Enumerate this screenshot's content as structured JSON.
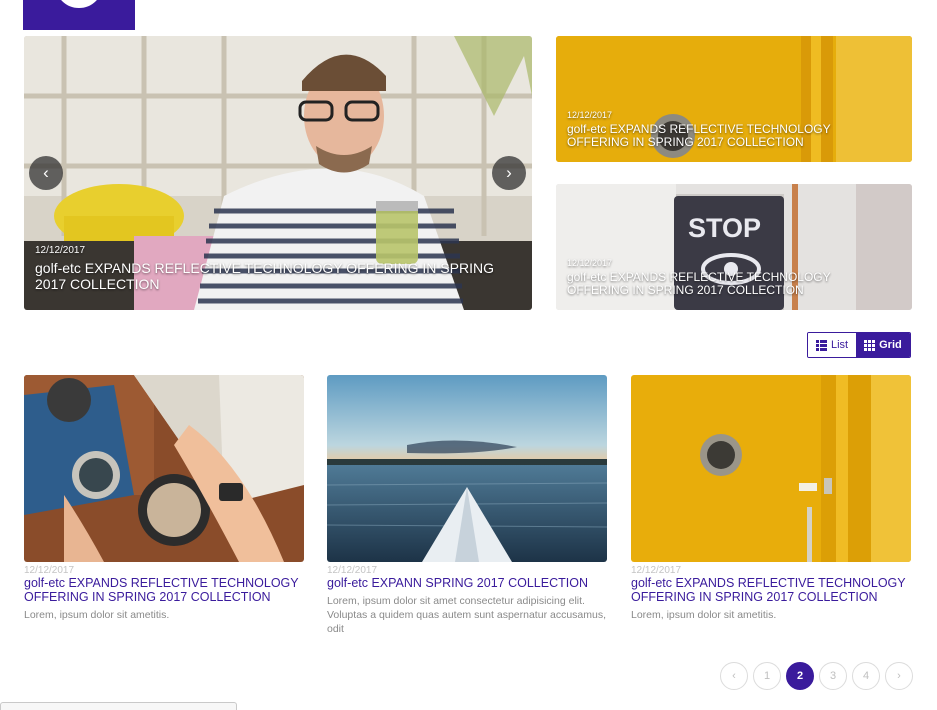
{
  "brand": {
    "logo_color": "#3a1b9c"
  },
  "featured": {
    "main": {
      "date": "12/12/2017",
      "title": "golf-etc EXPANDS REFLECTIVE TECHNOLOGY OFFERING IN SPRING 2017 COLLECTION",
      "prev_icon": "chevron-left-icon",
      "next_icon": "chevron-right-icon"
    },
    "side": [
      {
        "date": "12/12/2017",
        "title": "golf-etc EXPANDS REFLECTIVE TECHNOLOGY OFFERING IN SPRING 2017 COLLECTION"
      },
      {
        "date": "12/12/2017",
        "title": "golf-etc EXPANDS REFLECTIVE TECHNOLOGY OFFERING IN SPRING 2017 COLLECTION"
      }
    ]
  },
  "view_toggle": {
    "list_label": "List",
    "grid_label": "Grid",
    "active": "Grid"
  },
  "articles": [
    {
      "date": "12/12/2017",
      "title": "golf-etc EXPANDS REFLECTIVE TECHNOLOGY OFFERING IN SPRING 2017 COLLECTION",
      "desc": "Lorem, ipsum dolor sit ametitis."
    },
    {
      "date": "12/12/2017",
      "title": "golf-etc EXPANN SPRING 2017 COLLECTION",
      "desc": "Lorem, ipsum dolor sit amet consectetur adipisicing elit. Voluptas a quidem quas autem sunt aspernatur accusamus, odit"
    },
    {
      "date": "12/12/2017",
      "title": "golf-etc EXPANDS REFLECTIVE TECHNOLOGY OFFERING IN SPRING 2017 COLLECTION",
      "desc": "Lorem, ipsum dolor sit ametitis."
    }
  ],
  "pagination": {
    "prev": "‹",
    "pages": [
      "1",
      "2",
      "3",
      "4"
    ],
    "current": "2",
    "next": "›"
  },
  "colors": {
    "accent": "#3a1b9c",
    "yellow": "#e9b10f"
  }
}
